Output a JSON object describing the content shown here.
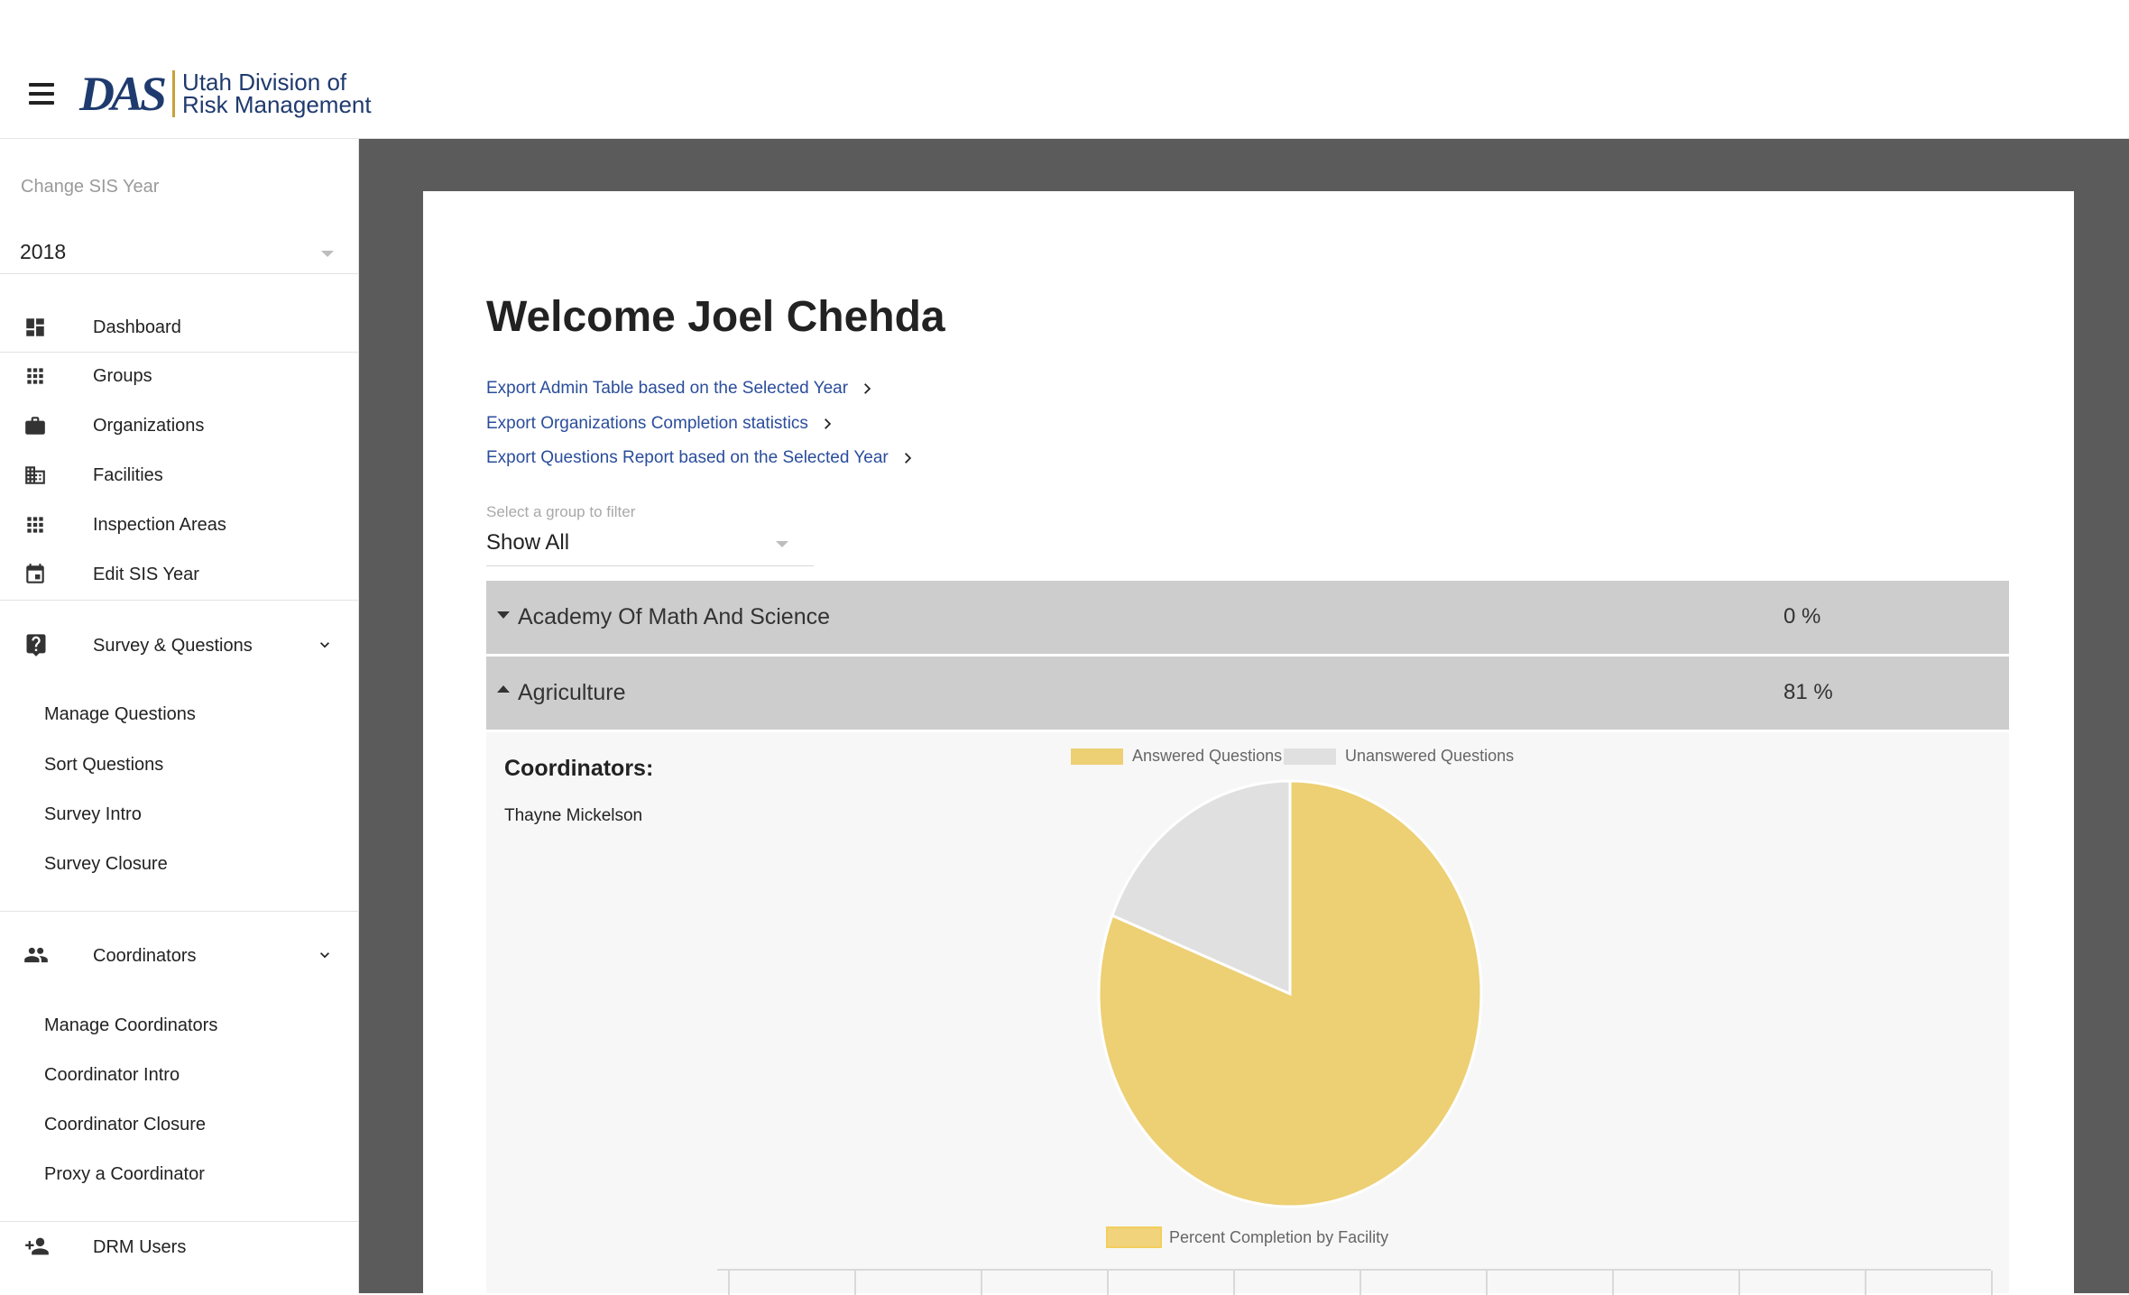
{
  "header": {
    "logo_mark": "DAS",
    "logo_line1": "Utah Division of",
    "logo_line2": "Risk Management"
  },
  "sidebar": {
    "sis_label": "Change SIS Year",
    "sis_year": "2018",
    "nav": [
      {
        "label": "Dashboard",
        "icon": "dashboard-icon"
      },
      {
        "label": "Groups",
        "icon": "apps-grid-icon"
      },
      {
        "label": "Organizations",
        "icon": "briefcase-icon"
      },
      {
        "label": "Facilities",
        "icon": "building-icon"
      },
      {
        "label": "Inspection Areas",
        "icon": "apps-grid-icon"
      },
      {
        "label": "Edit SIS Year",
        "icon": "calendar-icon"
      }
    ],
    "survey": {
      "label": "Survey & Questions",
      "icon": "question-icon",
      "items": [
        "Manage Questions",
        "Sort Questions",
        "Survey Intro",
        "Survey Closure"
      ]
    },
    "coordinators": {
      "label": "Coordinators",
      "icon": "people-icon",
      "items": [
        "Manage Coordinators",
        "Coordinator Intro",
        "Coordinator Closure",
        "Proxy a Coordinator"
      ]
    },
    "drm_users": {
      "label": "DRM Users",
      "icon": "add-person-icon"
    }
  },
  "main": {
    "welcome": "Welcome Joel Chehda",
    "exports": [
      "Export Admin Table based on the Selected Year",
      "Export Organizations Completion statistics",
      "Export Questions Report based on the Selected Year"
    ],
    "filter_label": "Select a group to filter",
    "filter_value": "Show All",
    "groups": [
      {
        "name": "Academy Of Math And Science",
        "percent": "0 %",
        "expanded": false
      },
      {
        "name": "Agriculture",
        "percent": "81 %",
        "expanded": true
      }
    ],
    "coordinators_title": "Coordinators:",
    "coordinator_names": [
      "Thayne Mickelson"
    ]
  },
  "colors": {
    "answered": "#edcf74",
    "unanswered": "#e0e0e0",
    "link": "#2a4d9b",
    "group_row": "#cdcdcd"
  },
  "chart_data": [
    {
      "type": "pie",
      "title": "",
      "legend_position": "top",
      "categories": [
        "Answered Questions",
        "Unanswered Questions"
      ],
      "values": [
        81,
        19
      ]
    },
    {
      "type": "bar",
      "title": "",
      "legend_position": "top",
      "series": [
        {
          "name": "Percent Completion by Facility",
          "values": []
        }
      ],
      "categories": []
    }
  ]
}
